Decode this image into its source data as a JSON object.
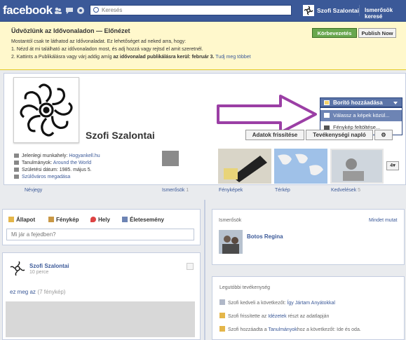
{
  "topbar": {
    "logo": "facebook",
    "search_placeholder": "Keresés",
    "user_name": "Szofi Szalontai",
    "links": [
      "Ismerősök keresé"
    ]
  },
  "welcome": {
    "title": "Üdvözlünk az Idővonaladon — Előnézet",
    "line1": "Mostantól csak te láthatod az Idővonaladat. Ez lehetőséget ad neked arra, hogy:",
    "line2": "1. Nézd át mi található az idővonaladon most, és adj hozzá vagy rejtsd el amit szeretnél.",
    "line3_prefix": "2. Kattints a Publikálásra vagy várj addig amíg ",
    "line3_bold": "az idővonalad publikálásra kerül: február 3.",
    "line3_link": "Tudj meg többet",
    "continue_label": "Körbevezetés",
    "publish_label": "Publish Now"
  },
  "profile": {
    "name": "Szofi Szalontai",
    "cover_button": "Borító hozzáadása",
    "cover_menu": [
      "Válassz a képek közül...",
      "Fénykép feltöltése..."
    ],
    "update_button": "Adatok frissítése",
    "activity_button": "Tevékenységi napló",
    "info": [
      {
        "label": "Jelenlegi munkahely: ",
        "value": "Hogyankell.hu"
      },
      {
        "label": "Tanulmányok: ",
        "value": "Around the World"
      },
      {
        "label": "Születési dátum: 1985. május 5.",
        "value": ""
      },
      {
        "label": "",
        "value": "Szülőváros megadása"
      }
    ],
    "about_label": "Névjegy",
    "tiles": [
      {
        "label": "Ismerősök",
        "count": "1"
      },
      {
        "label": "Fényképek",
        "count": ""
      },
      {
        "label": "Térkép",
        "count": ""
      },
      {
        "label": "Kedvelések",
        "count": "5"
      }
    ],
    "more_count": "4"
  },
  "composer": {
    "tabs": [
      "Állapot",
      "Fénykép",
      "Hely",
      "Életesemény"
    ],
    "placeholder": "Mi jár a fejedben?"
  },
  "post": {
    "author": "Szofi Szalontai",
    "time": "10 perce",
    "title": "ez meg az",
    "photo_count": "(7 fénykép)"
  },
  "friends": {
    "heading": "Ismerősök",
    "see_all": "Mindet mutat",
    "friend_name": "Botos Regina"
  },
  "activity": {
    "heading": "Legutóbbi tevékenység",
    "items": [
      {
        "prefix": "Szofi kedveli a következőt: ",
        "link": "Így Jártam Anyátokkal",
        "suffix": ""
      },
      {
        "prefix": "Szofi frissítette az ",
        "link": "Idézetek",
        "suffix": " részt az adatlapján"
      },
      {
        "prefix": "Szofi hozzáadta a ",
        "link": "Tanulmányok",
        "suffix": "hoz a következőt: Ide és oda."
      }
    ]
  },
  "colors": {
    "brand": "#3b5998",
    "accent_green": "#69a74e",
    "highlight_arrow": "#9b3fa5"
  }
}
